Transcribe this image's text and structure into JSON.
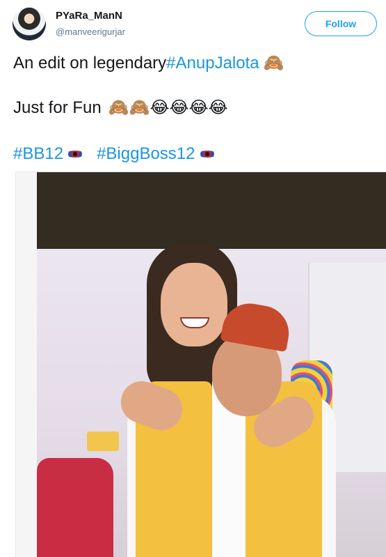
{
  "tweet": {
    "display_name": "PYaRa_ManN",
    "username": "@manveerigurjar",
    "follow_label": "Follow",
    "line1_text": "An edit on legendary ",
    "line1_hashtag": "#AnupJalota",
    "line1_emoji": "🙈",
    "line2_text": "Just for Fun",
    "line2_emojis": "🙈🙈😂😂😂😂",
    "hashtag_1": "#BB12",
    "hashtag_2": "#BiggBoss12"
  },
  "icons": {
    "hashflag": "bigg-boss-eye-icon",
    "see_no_evil": "see-no-evil-monkey-emoji",
    "laughing": "face-with-tears-of-joy-emoji"
  },
  "colors": {
    "link": "#1b95e0",
    "follow_border": "#1da1f2",
    "text": "#14171a",
    "muted": "#657786"
  }
}
